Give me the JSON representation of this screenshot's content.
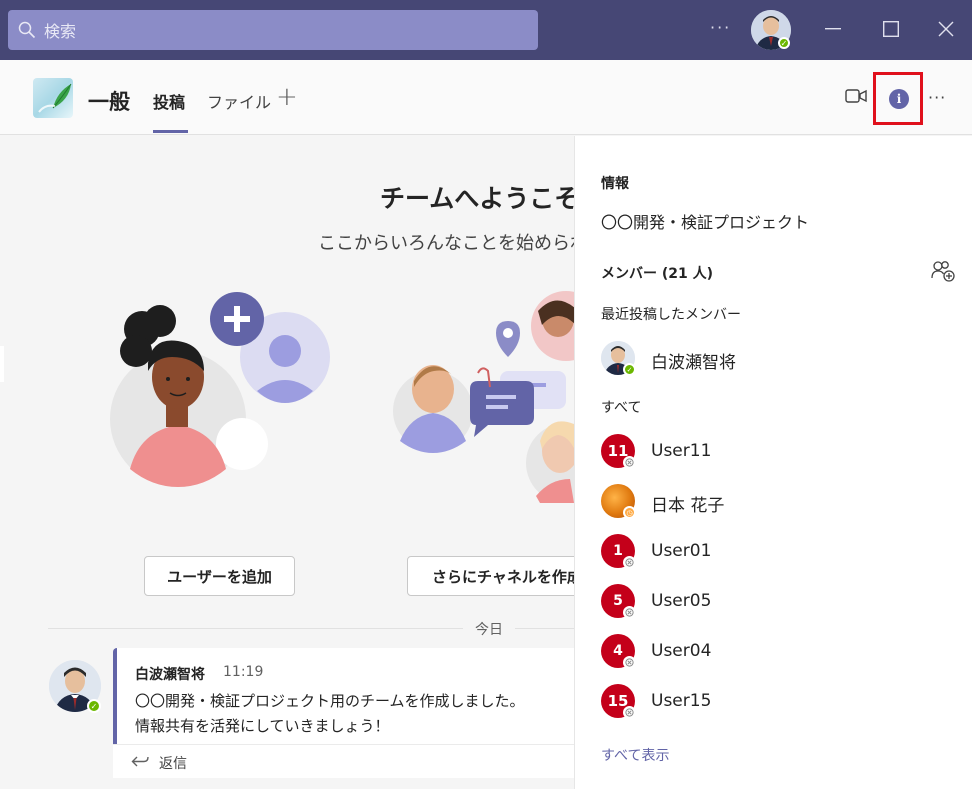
{
  "search": {
    "placeholder": "検索"
  },
  "titlebar": {
    "more": "···"
  },
  "channel": {
    "name": "一般",
    "tabs": [
      {
        "label": "投稿",
        "active": true
      },
      {
        "label": "ファイル",
        "active": false
      }
    ],
    "add_tab": "+",
    "more": "···"
  },
  "welcome": {
    "title": "チームへようこそ!",
    "subtitle": "ここからいろんなことを始められ",
    "add_user_button": "ユーザーを追加",
    "create_channel_button": "さらにチャネルを作成"
  },
  "feed": {
    "date_divider": "今日",
    "message": {
      "author": "白波瀬智将",
      "time": "11:19",
      "lines": [
        "〇〇開発・検証プロジェクト用のチームを作成しました。",
        "情報共有を活発にしていきましょう！"
      ],
      "reply_label": "返信"
    }
  },
  "panel": {
    "heading": "情報",
    "team_name": "〇〇開発・検証プロジェクト",
    "members_label": "メンバー (21 人)",
    "recent_label": "最近投稿したメンバー",
    "recent_members": [
      {
        "name": "白波瀬智将",
        "status": "available"
      }
    ],
    "all_label": "すべて",
    "members": [
      {
        "name": "User11",
        "badge": "11",
        "status": "offline"
      },
      {
        "name": "日本 花子",
        "badge": "",
        "status": "away"
      },
      {
        "name": "User01",
        "badge": "1",
        "status": "offline"
      },
      {
        "name": "User05",
        "badge": "5",
        "status": "offline"
      },
      {
        "name": "User04",
        "badge": "4",
        "status": "offline"
      },
      {
        "name": "User15",
        "badge": "15",
        "status": "offline"
      }
    ],
    "show_all": "すべて表示"
  },
  "colors": {
    "titlebar": "#464775",
    "accent": "#6264a7",
    "highlight_box": "#e0101c",
    "available": "#6bb700",
    "away": "#ffaa44",
    "member_badge": "#c4001a"
  }
}
